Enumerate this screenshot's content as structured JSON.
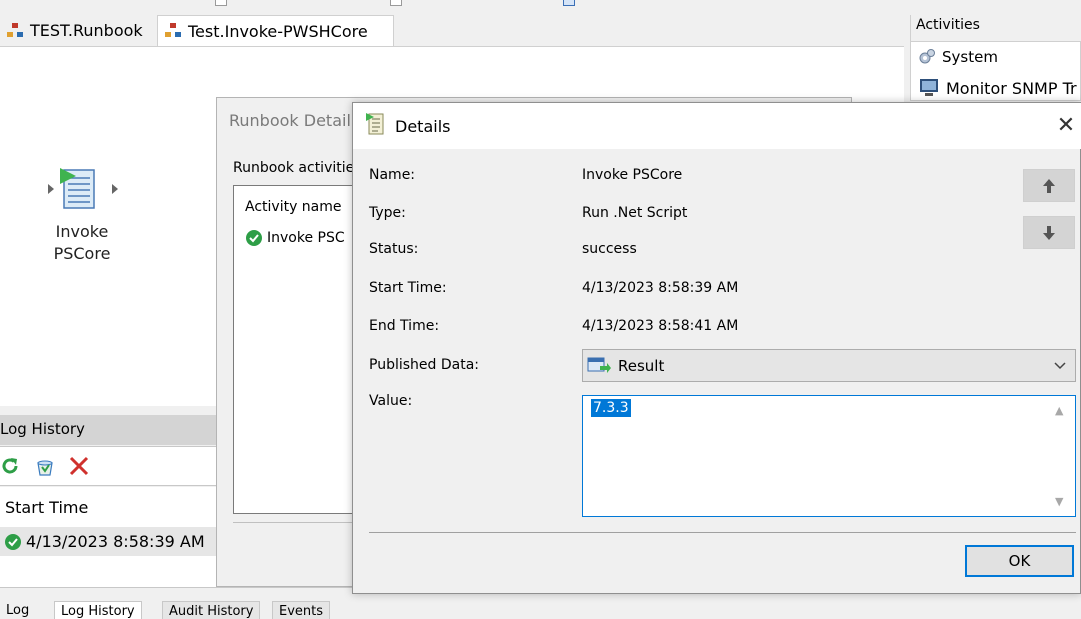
{
  "tabs": [
    {
      "label": "TEST.Runbook",
      "active": false
    },
    {
      "label": "Test.Invoke-PWSHCore",
      "active": true
    }
  ],
  "activity": {
    "label_line1": "Invoke",
    "label_line2": "PSCore",
    "icon": "script-activity-icon"
  },
  "activities_pane": {
    "title": "Activities",
    "items": [
      {
        "label": "System",
        "icon": "gears-icon"
      },
      {
        "label": "Monitor SNMP Tr",
        "icon": "monitor-icon"
      }
    ]
  },
  "log_history": {
    "title": "Log History",
    "column": "Start Time",
    "rows": [
      {
        "time": "4/13/2023 8:58:39 AM",
        "status": "success"
      }
    ]
  },
  "bottom_tabs": [
    "Log",
    "Log History",
    "Audit History",
    "Events"
  ],
  "runbook_details": {
    "title": "Runbook Detail",
    "list_label": "Runbook activitie",
    "column": "Activity name",
    "rows": [
      {
        "name": "Invoke PSC",
        "status": "success"
      }
    ]
  },
  "dialog": {
    "title": "Details",
    "fields": {
      "name_label": "Name:",
      "name_value": "Invoke PSCore",
      "type_label": "Type:",
      "type_value": "Run .Net Script",
      "status_label": "Status:",
      "status_value": "success",
      "start_label": "Start Time:",
      "start_value": "4/13/2023 8:58:39 AM",
      "end_label": "End Time:",
      "end_value": "4/13/2023 8:58:41 AM",
      "published_label": "Published Data:",
      "published_value": "Result",
      "value_label": "Value:",
      "value_text": "7.3.3"
    },
    "ok_label": "OK"
  },
  "colors": {
    "accent": "#0078d7",
    "success": "#2e9e47",
    "delete": "#d0312d"
  }
}
